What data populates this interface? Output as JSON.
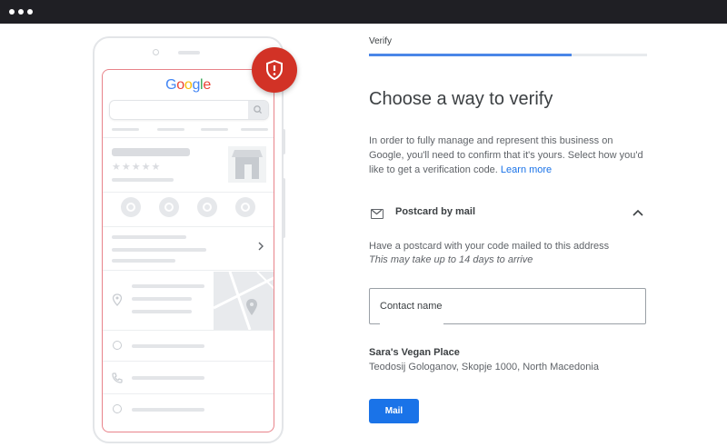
{
  "illustration": {
    "logo_letters": [
      "G",
      "o",
      "o",
      "g",
      "l",
      "e"
    ],
    "logo_colors": [
      "#4285f4",
      "#ea4335",
      "#fbbc05",
      "#4285f4",
      "#34a853",
      "#ea4335"
    ],
    "rating_stars": "★★★★★",
    "shield_color": "#d23226"
  },
  "verify": {
    "step_label": "Verify",
    "progress_percent": 73,
    "heading": "Choose a way to verify",
    "intro_text": "In order to fully manage and represent this business on Google, you'll need to confirm that it's yours. Select how you'd like to get a verification code.",
    "learn_more": "Learn more",
    "option_title": "Postcard by mail",
    "option_icon": "mail-icon",
    "option_desc": "Have a postcard with your code mailed to this address",
    "option_note": "This may take up to 14 days to arrive",
    "contact_placeholder": "Contact name",
    "business_name": "Sara's Vegan Place",
    "business_address": "Teodosij Gologanov, Skopje 1000, North Macedonia",
    "mail_button": "Mail",
    "accent_color": "#1a73e8"
  }
}
